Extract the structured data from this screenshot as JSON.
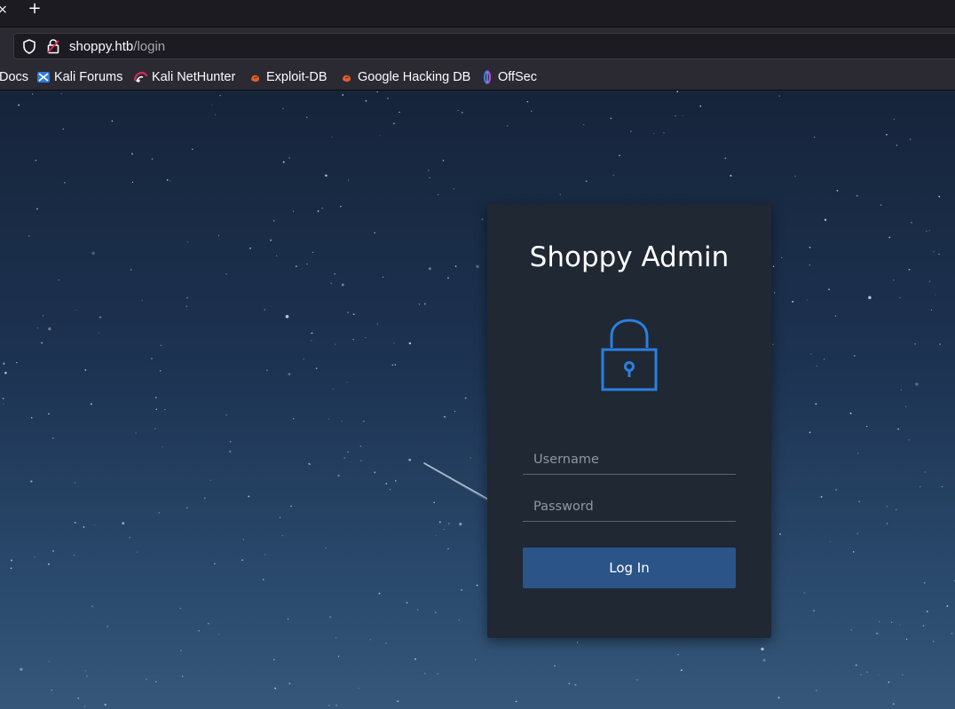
{
  "browser": {
    "tab_close_glyph": "×",
    "new_tab_glyph": "+",
    "url": {
      "host": "shoppy.htb",
      "path": "/login"
    },
    "bookmarks": [
      {
        "label": "Docs",
        "icon": "kali-docs-icon"
      },
      {
        "label": "Kali Forums",
        "icon": "kali-forums-icon"
      },
      {
        "label": "Kali NetHunter",
        "icon": "kali-nethunter-icon"
      },
      {
        "label": "Exploit-DB",
        "icon": "exploit-db-icon"
      },
      {
        "label": "Google Hacking DB",
        "icon": "google-hacking-db-icon"
      },
      {
        "label": "OffSec",
        "icon": "offsec-icon"
      }
    ]
  },
  "login": {
    "title": "Shoppy Admin",
    "icon": "padlock-icon",
    "accent_color": "#2b7fe0",
    "username_placeholder": "Username",
    "password_placeholder": "Password",
    "submit_label": "Log In",
    "button_color": "#2b5489"
  }
}
